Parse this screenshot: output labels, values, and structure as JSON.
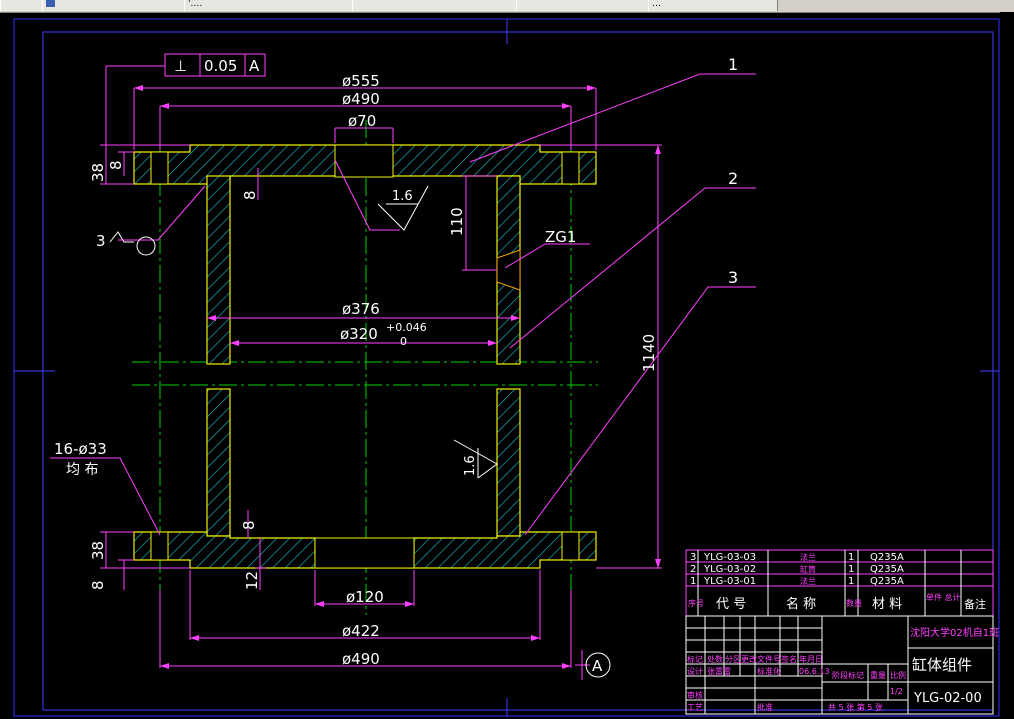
{
  "tabs": [
    {
      "label": ""
    },
    {
      "label": "'.…"
    },
    {
      "label": ""
    },
    {
      "label": ""
    },
    {
      "label": "…"
    }
  ],
  "drawing": {
    "tolerance": {
      "symbol": "⊥",
      "value": "0.05",
      "datum": "A"
    },
    "dims": {
      "d555": "ø555",
      "d490_top": "ø490",
      "d70": "ø70",
      "d376": "ø376",
      "d320": "ø320",
      "d320_tol_upper": "+0.046",
      "d320_tol_lower": "0",
      "d120": "ø120",
      "d422": "ø422",
      "d490_bottom": "ø490",
      "h1140": "1140",
      "h110": "110",
      "h38_top": "38",
      "h8_top": "8",
      "h8_inner": "8",
      "h38_bot": "38",
      "h8_bot": "8",
      "h8_bot2": "8",
      "h12": "12",
      "rough_top": "1.6",
      "rough_side": "1.6",
      "weld": "3",
      "zg": "ZG1",
      "holes_count": "16-ø33",
      "holes_even": "均 布",
      "datum_a": "A"
    },
    "balloons": [
      "1",
      "2",
      "3"
    ]
  },
  "title_block": {
    "parts": [
      {
        "no": "3",
        "code": "YLG-03-03",
        "name": "法兰",
        "qty": "1",
        "material": "Q235A"
      },
      {
        "no": "2",
        "code": "YLG-03-02",
        "name": "缸筒",
        "qty": "1",
        "material": "Q235A"
      },
      {
        "no": "1",
        "code": "YLG-03-01",
        "name": "法兰",
        "qty": "1",
        "material": "Q235A"
      }
    ],
    "header": {
      "no": "序号",
      "code": "代 号",
      "name": "名 称",
      "qty": "数量",
      "material": "材 料",
      "weight": "单件 总计",
      "note": "备注"
    },
    "school": "沈阳大学02机自1班",
    "drawing_name": "缸体组件",
    "drawing_no": "YLG-02-00",
    "scale": "1/2",
    "sheet": "共 5 张  第 5 张",
    "labels": {
      "mark": "标记",
      "count": "处数",
      "zone": "分区",
      "change_doc": "更改文件号",
      "sign": "签名",
      "date": "年月日",
      "design": "设计",
      "designer": "张雷雷",
      "std": "标准化",
      "stage": "阶段标记",
      "weight": "重量",
      "ratio": "比例",
      "review": "审核",
      "process": "工艺",
      "approve": "批准",
      "date_val": "06.6.13"
    }
  }
}
